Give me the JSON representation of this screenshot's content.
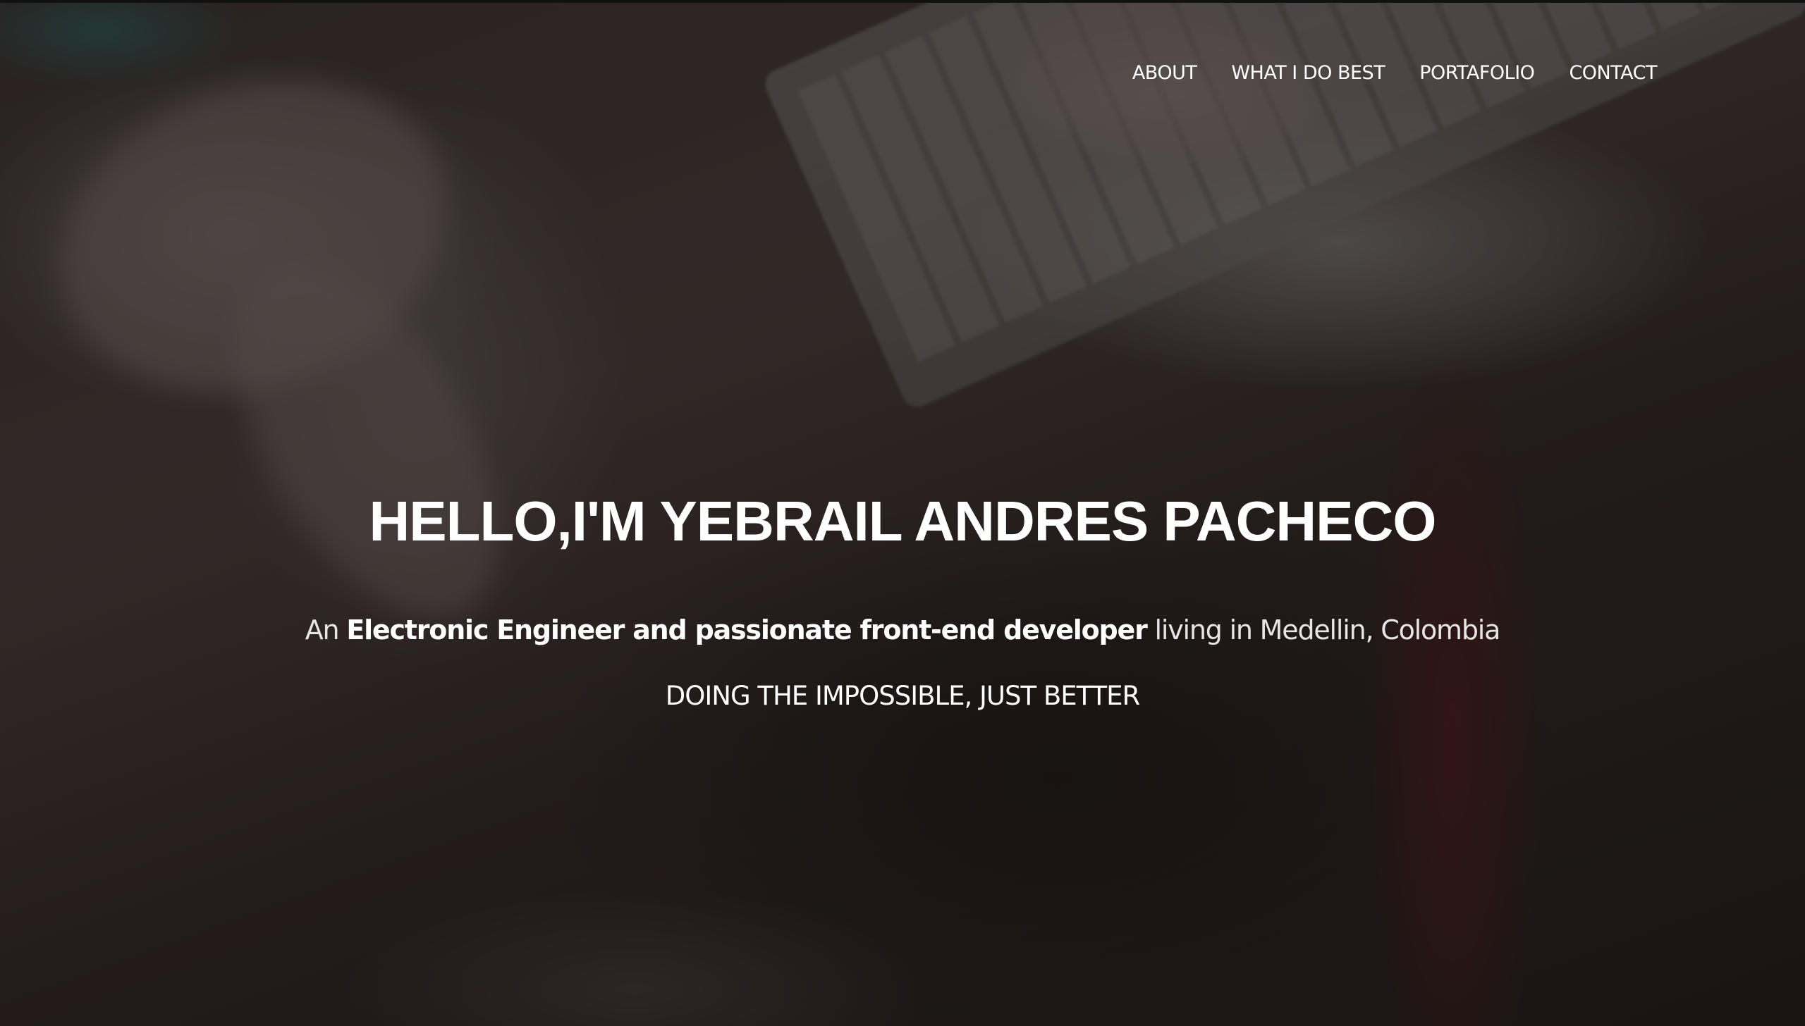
{
  "nav": {
    "items": [
      {
        "label": "ABOUT"
      },
      {
        "label": "WHAT I DO BEST"
      },
      {
        "label": "PORTAFOLIO"
      },
      {
        "label": "CONTACT"
      }
    ]
  },
  "hero": {
    "title": "HELLO,I'M YEBRAIL ANDRES PACHECO",
    "subtitle_prefix": "An ",
    "subtitle_highlight": "Electronic Engineer and passionate front-end developer",
    "subtitle_suffix": " living in Medellin, Colombia",
    "tagline": "DOING THE IMPOSSIBLE, JUST BETTER",
    "background_image": "hands-typing-on-keyboard-photo"
  },
  "colors": {
    "text": "#ffffff",
    "overlay": "#14100f"
  }
}
